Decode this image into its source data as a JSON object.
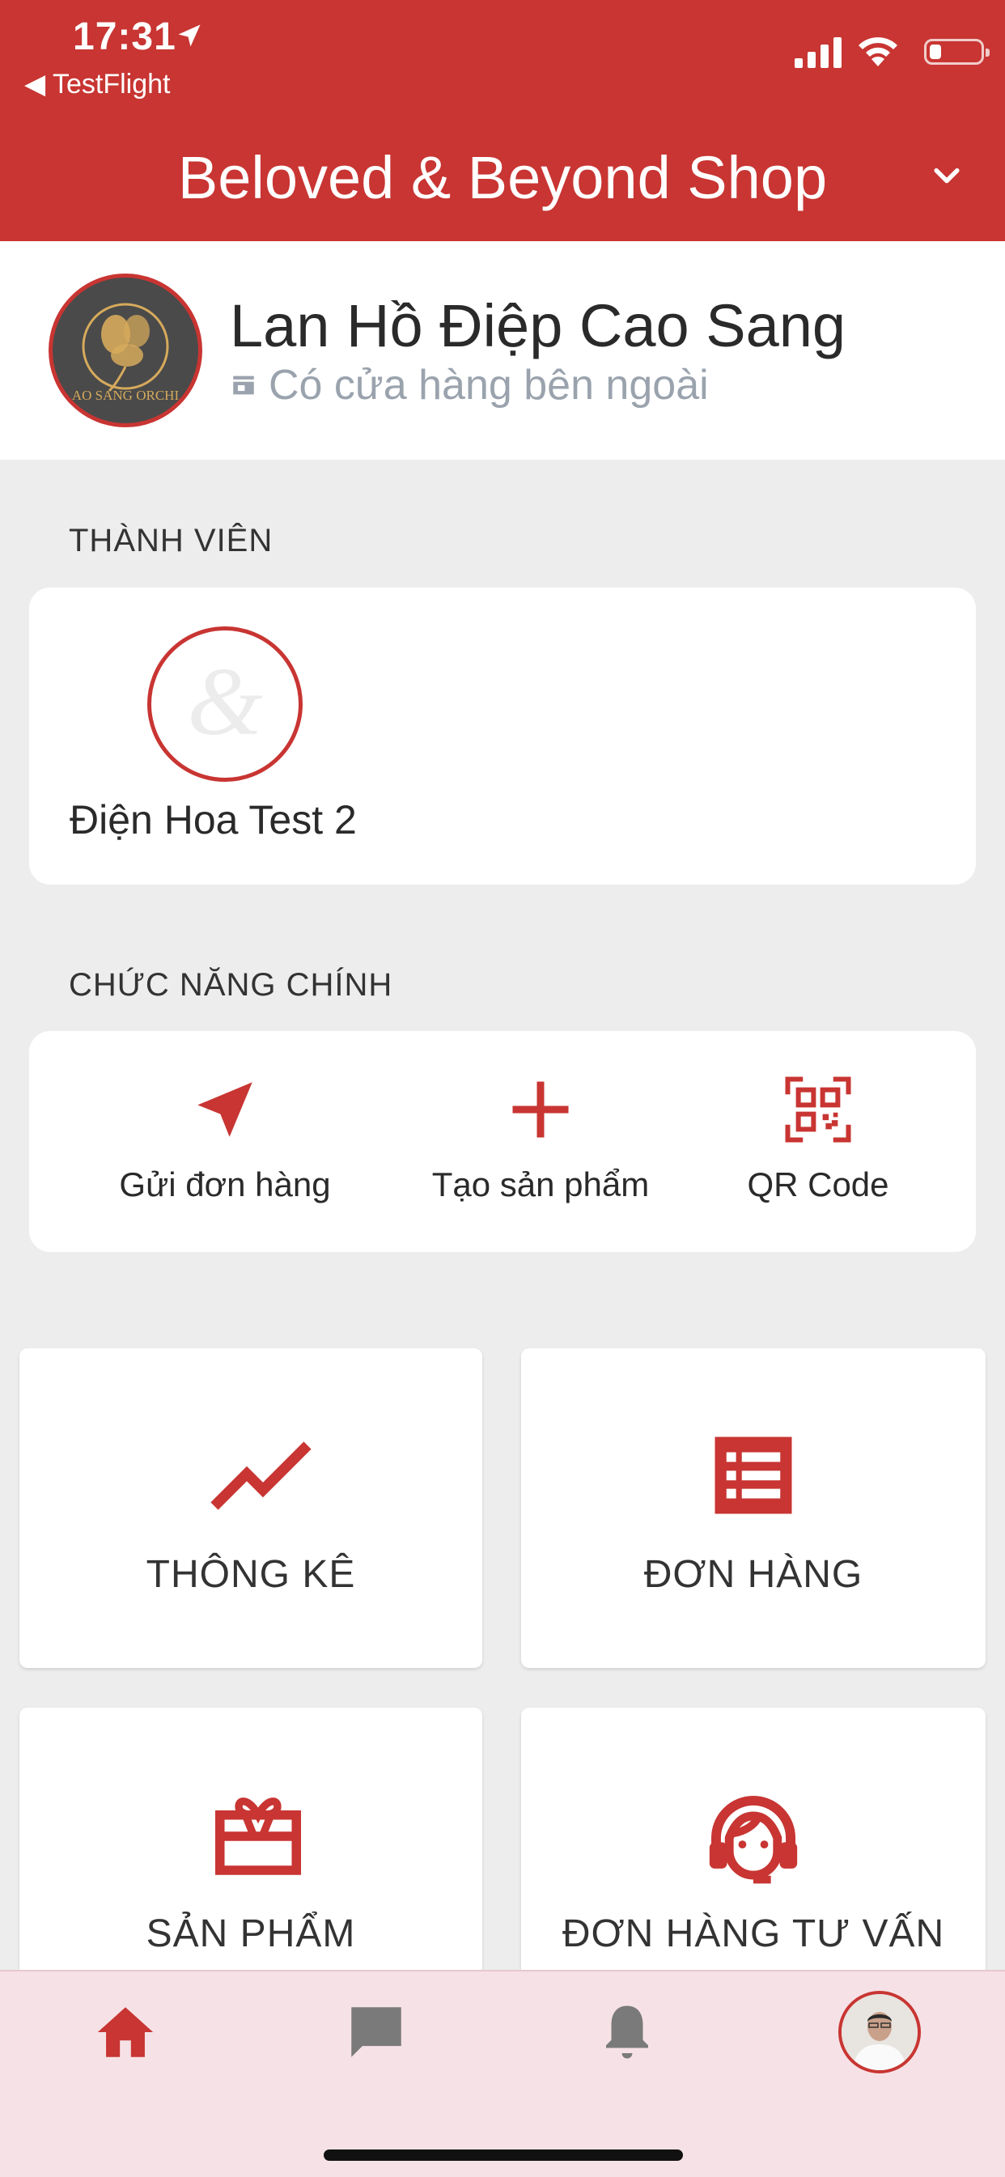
{
  "status_bar": {
    "time": "17:31",
    "back_app": "◀ TestFlight"
  },
  "header": {
    "shop_title": "Beloved & Beyond Shop"
  },
  "store": {
    "name": "Lan Hồ Điệp Cao Sang",
    "subtitle": "Có cửa hàng bên ngoài",
    "logo_text": "AO SANG ORCHI"
  },
  "members": {
    "section_label": "THÀNH VIÊN",
    "items": [
      {
        "name": "Điện Hoa Test 2"
      }
    ]
  },
  "main_functions": {
    "section_label": "CHỨC NĂNG CHÍNH",
    "items": [
      {
        "label": "Gửi đơn hàng",
        "icon": "send-icon"
      },
      {
        "label": "Tạo sản phẩm",
        "icon": "plus-icon"
      },
      {
        "label": "QR Code",
        "icon": "qr-code-icon"
      }
    ]
  },
  "tiles": [
    {
      "label": "THÔNG KÊ",
      "icon": "trending-icon"
    },
    {
      "label": "ĐƠN HÀNG",
      "icon": "list-icon"
    },
    {
      "label": "SẢN PHẨM",
      "icon": "gift-card-icon"
    },
    {
      "label": "ĐƠN HÀNG TƯ VẤN",
      "icon": "headset-icon"
    }
  ],
  "bottom_nav": {
    "items": [
      "home-icon",
      "chat-icon",
      "bell-icon",
      "profile-avatar"
    ],
    "active": "home-icon"
  },
  "colors": {
    "accent": "#c83532",
    "background": "#ededed",
    "nav_background": "#f6e2e6"
  }
}
